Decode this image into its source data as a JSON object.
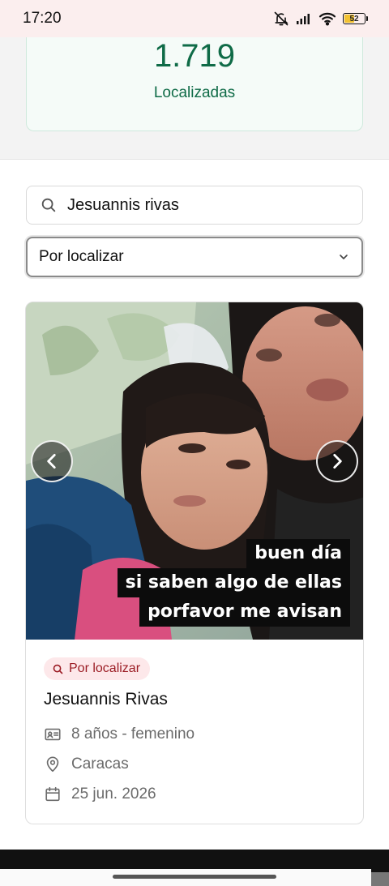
{
  "status_bar": {
    "time": "17:20",
    "battery": "52"
  },
  "stats": {
    "value": "1.719",
    "label": "Localizadas"
  },
  "search": {
    "value": "Jesuannis rivas",
    "placeholder": ""
  },
  "filter": {
    "selected": "Por localizar"
  },
  "card": {
    "photo_caption": [
      "buen día",
      "si saben algo de ellas",
      "porfavor me avisan"
    ],
    "badge": "Por localizar",
    "name": "Jesuannis Rivas",
    "age_gender": "8 años - femenino",
    "city": "Caracas",
    "date": "25 jun. 2026"
  },
  "colors": {
    "accent_green": "#0f6b47",
    "badge_bg": "#fde8ea",
    "badge_text": "#9b1c24"
  },
  "icons": [
    "bell-off-icon",
    "signal-icon",
    "wifi-icon",
    "battery-icon",
    "search-icon",
    "chevron-down-icon",
    "chevron-left-icon",
    "chevron-right-icon",
    "id-card-icon",
    "map-pin-icon",
    "calendar-icon"
  ]
}
